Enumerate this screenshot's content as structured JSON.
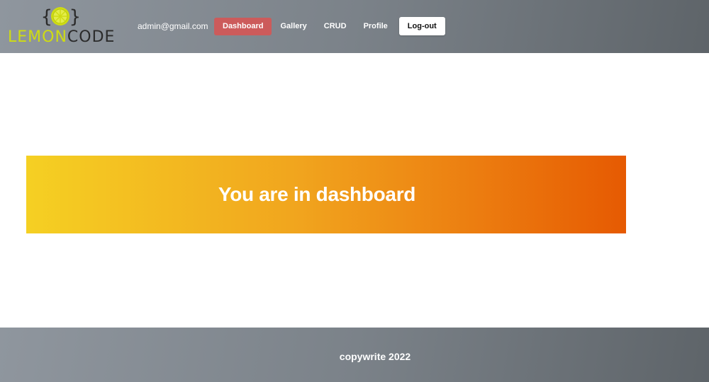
{
  "header": {
    "logo": {
      "part1": "LEMON",
      "part2": "CODE",
      "brand_color": "#cfdc12"
    },
    "user_email": "admin@gmail.com",
    "nav": [
      {
        "label": "Dashboard",
        "active": true
      },
      {
        "label": "Gallery"
      },
      {
        "label": "CRUD"
      },
      {
        "label": "Profile"
      }
    ],
    "logout_label": "Log-out"
  },
  "main": {
    "banner_title": "You are in dashboard",
    "banner_colors": [
      "#f5d023",
      "#e65a02"
    ]
  },
  "footer": {
    "text": "copywrite 2022"
  }
}
